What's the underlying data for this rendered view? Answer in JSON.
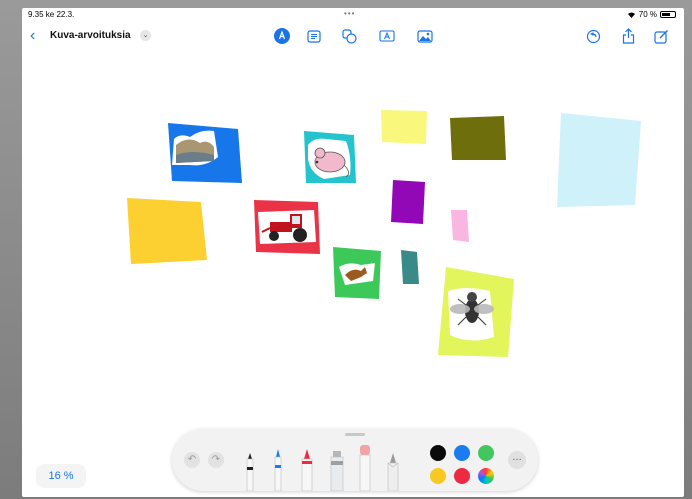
{
  "status_bar": {
    "time_date": "9.35  ke 22.3.",
    "dots": "•••",
    "battery_percent": "70 %",
    "battery_level": 0.7
  },
  "header": {
    "back_glyph": "‹",
    "title": "Kuva-arvoituksia",
    "title_menu_glyph": "⌄"
  },
  "toolbar_icons": [
    "pen-tool-icon",
    "text-box-icon",
    "shapes-icon",
    "text-icon",
    "media-icon",
    "undo-history-icon",
    "share-icon",
    "edit-icon"
  ],
  "canvas": {
    "colors": {
      "blue_card": "#1777ea",
      "cyan_card": "#24c4ce",
      "pale_yellow": "#f9f87d",
      "olive": "#6e6e0c",
      "light_blue": "#cff1fa",
      "yellow_card": "#fcd030",
      "red_card": "#ea3347",
      "purple": "#9208b6",
      "pink": "#f8b6e0",
      "green_card": "#3dc85a",
      "teal": "#3a8a88",
      "lime_card": "#e2f55a"
    }
  },
  "drawing_toolbar": {
    "undo_glyph": "↶",
    "redo_glyph": "↷",
    "tools": [
      "pen-tool",
      "fineliner-tool",
      "marker-tool",
      "highlighter-tool",
      "eraser-tool",
      "pencil-tool"
    ],
    "swatches": [
      "#0a0a0a",
      "#1a7cf0",
      "#44c65e",
      "#f8c823",
      "#ee2a42",
      "multicolor"
    ],
    "more_glyph": "…"
  },
  "zoom_level": "16 %"
}
